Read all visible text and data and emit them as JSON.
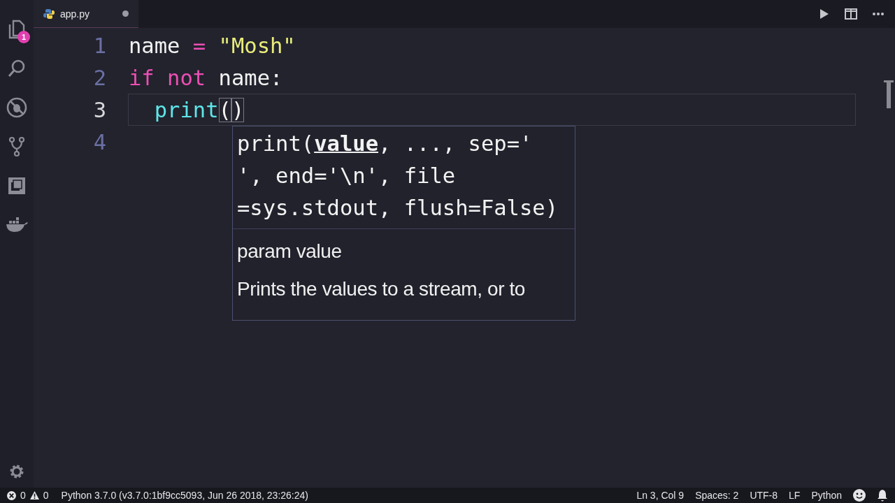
{
  "activity_bar": {
    "explorer_badge": "1"
  },
  "tabs": [
    {
      "label": "app.py",
      "selected": true,
      "dirty": true
    }
  ],
  "editor": {
    "lines": [
      {
        "number": "1",
        "current": false,
        "tokens": [
          {
            "text": "name",
            "kind": "plain"
          },
          {
            "text": " =",
            "kind": "operator"
          },
          {
            "text": " \"Mosh\"",
            "kind": "string"
          }
        ]
      },
      {
        "number": "2",
        "current": false,
        "tokens": [
          {
            "text": "if",
            "kind": "keyword"
          },
          {
            "text": " not",
            "kind": "keyword"
          },
          {
            "text": " name:",
            "kind": "plain"
          }
        ]
      },
      {
        "number": "3",
        "current": true,
        "tokens": [
          {
            "text": "  print",
            "kind": "function"
          },
          {
            "text": "(",
            "kind": "bracket-match"
          },
          {
            "text": ")",
            "kind": "bracket-match"
          }
        ]
      },
      {
        "number": "4",
        "current": false
      }
    ]
  },
  "signature_help": {
    "signature_lines": [
      "print(**value**, ..., sep='",
      "', end='\\n', file",
      "=sys.stdout, flush=False)"
    ],
    "param": "param value",
    "doc": "Prints the values to a stream, or to"
  },
  "status_bar": {
    "errors": "0",
    "warnings": "0",
    "interpreter": "Python 3.7.0 (v3.7.0:1bf9cc5093, Jun 26 2018, 23:26:24)",
    "right_items": [
      "Ln 3, Col 9",
      "Spaces: 2",
      "UTF-8",
      "LF",
      "Python"
    ]
  }
}
